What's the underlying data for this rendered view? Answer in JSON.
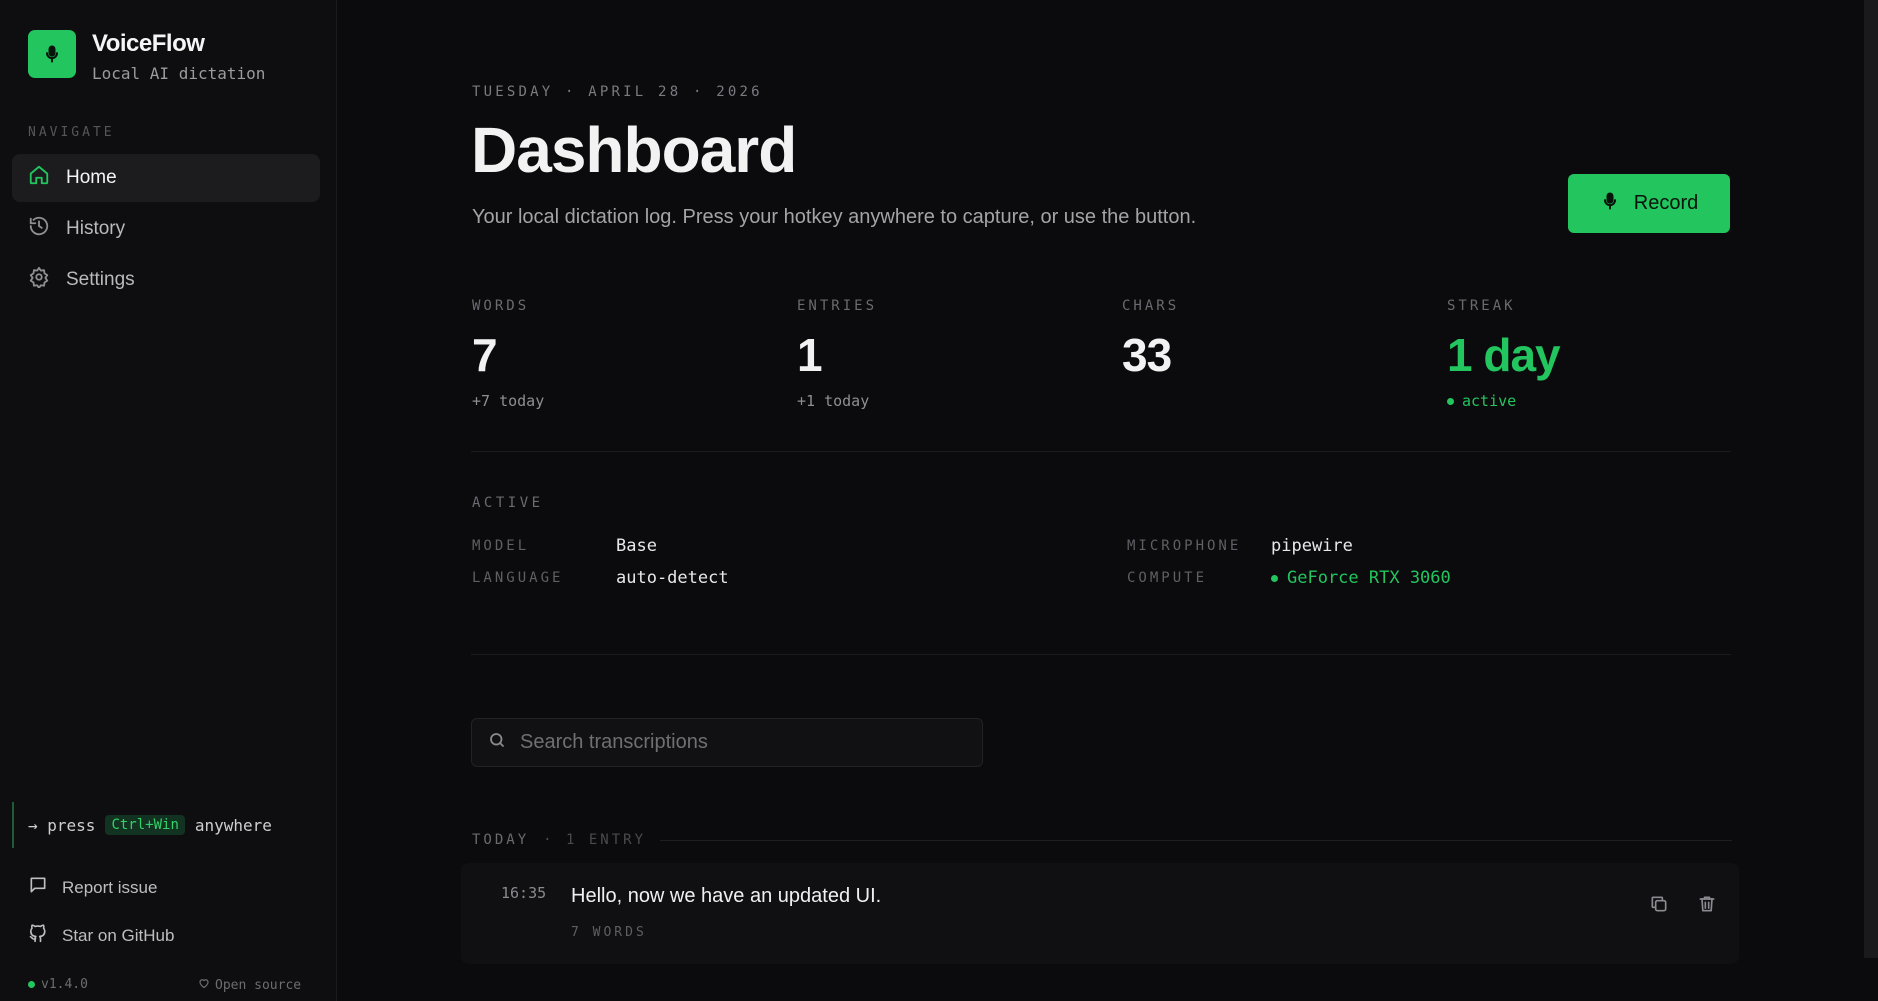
{
  "app": {
    "name": "VoiceFlow",
    "subtitle": "Local AI dictation",
    "logo_icon": "microphone-icon",
    "accent": "#22c55e"
  },
  "sidebar": {
    "heading": "NAVIGATE",
    "items": [
      {
        "label": "Home",
        "icon": "home-icon",
        "active": true
      },
      {
        "label": "History",
        "icon": "history-icon",
        "active": false
      },
      {
        "label": "Settings",
        "icon": "gear-icon",
        "active": false
      }
    ],
    "hint": {
      "prefix": "→ press",
      "key": "Ctrl+Win",
      "suffix": "anywhere"
    },
    "links": [
      {
        "label": "Report issue",
        "icon": "chat-icon"
      },
      {
        "label": "Star on GitHub",
        "icon": "github-icon"
      }
    ],
    "version": "v1.4.0",
    "open_source": "Open source"
  },
  "header": {
    "date": "TUESDAY · APRIL 28 · 2026",
    "title": "Dashboard",
    "subtitle": "Your local dictation log. Press your hotkey anywhere to capture, or use the button.",
    "record_label": "Record"
  },
  "stats": [
    {
      "label": "WORDS",
      "value": "7",
      "delta": "+7 today"
    },
    {
      "label": "ENTRIES",
      "value": "1",
      "delta": "+1 today"
    },
    {
      "label": "CHARS",
      "value": "33",
      "delta": ""
    },
    {
      "label": "STREAK",
      "value": "1 day",
      "delta": "active"
    }
  ],
  "active": {
    "heading": "ACTIVE",
    "model_label": "MODEL",
    "model": "Base",
    "language_label": "LANGUAGE",
    "language": "auto-detect",
    "microphone_label": "MICROPHONE",
    "microphone": "pipewire",
    "compute_label": "COMPUTE",
    "compute": "GeForce RTX 3060"
  },
  "search": {
    "placeholder": "Search transcriptions",
    "value": ""
  },
  "log": {
    "group_label": "TODAY",
    "group_count": "· 1 ENTRY",
    "entries": [
      {
        "time": "16:35",
        "text": "Hello, now we have an updated UI.",
        "words": "7 WORDS"
      }
    ]
  }
}
